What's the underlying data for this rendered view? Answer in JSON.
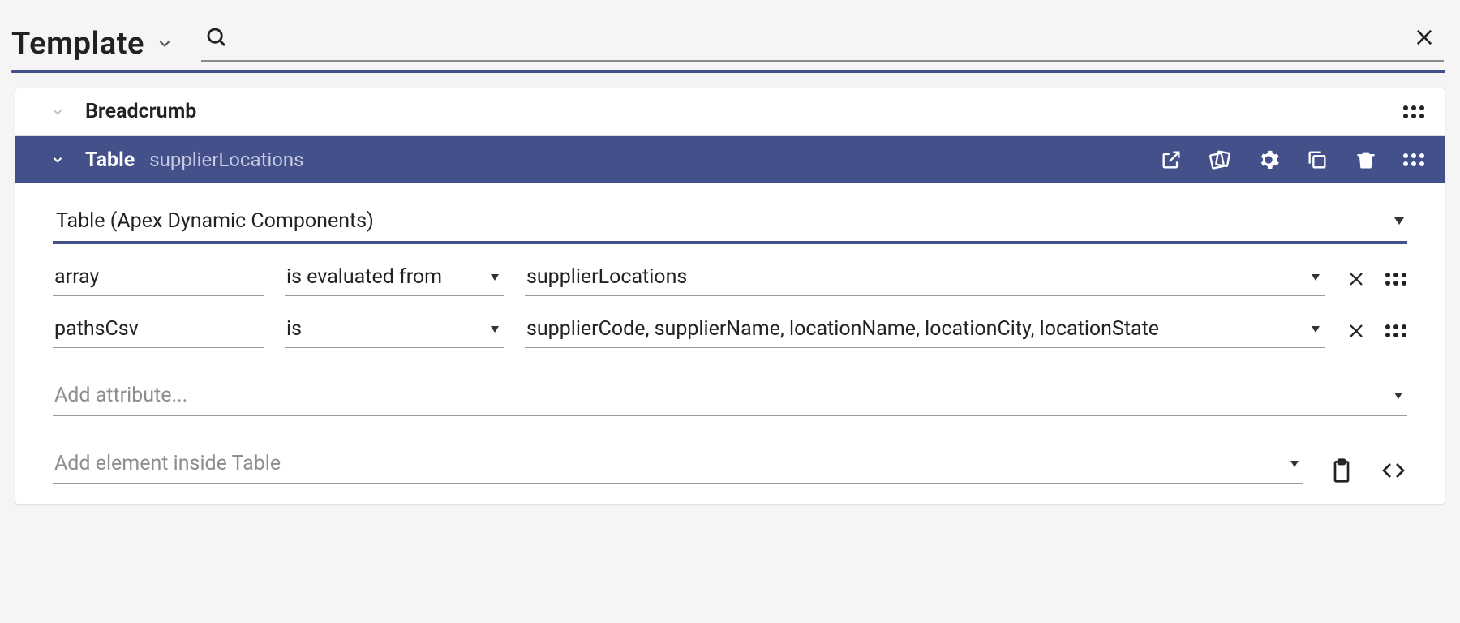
{
  "header": {
    "title": "Template",
    "searchPlaceholder": ""
  },
  "breadcrumb": {
    "label": "Breadcrumb"
  },
  "tableHeader": {
    "kind": "Table",
    "name": "supplierLocations"
  },
  "componentSelect": "Table (Apex Dynamic Components)",
  "attrs": {
    "0": {
      "name": "array",
      "operator": "is evaluated from",
      "value": "supplierLocations"
    },
    "1": {
      "name": "pathsCsv",
      "operator": "is",
      "value": "supplierCode, supplierName, locationName, locationCity, locationState"
    }
  },
  "addAttributePlaceholder": "Add attribute...",
  "addElementPlaceholder": "Add element inside Table"
}
